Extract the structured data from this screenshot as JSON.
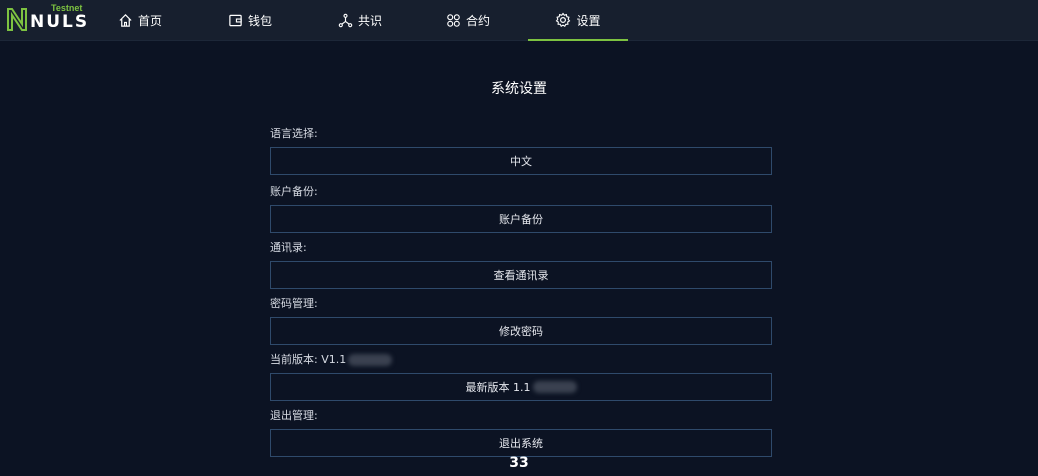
{
  "brand": {
    "name": "NULS",
    "network": "Testnet",
    "accent": "#7dc241"
  },
  "nav": {
    "items": [
      {
        "label": "首页",
        "icon": "home-icon"
      },
      {
        "label": "钱包",
        "icon": "wallet-icon"
      },
      {
        "label": "共识",
        "icon": "consensus-icon"
      },
      {
        "label": "合约",
        "icon": "contract-icon"
      },
      {
        "label": "设置",
        "icon": "gear-icon",
        "active": true
      }
    ]
  },
  "page": {
    "title": "系统设置"
  },
  "settings": {
    "language": {
      "label": "语言选择:",
      "value": "中文"
    },
    "backup": {
      "label": "账户备份:",
      "value": "账户备份"
    },
    "contacts": {
      "label": "通讯录:",
      "value": "查看通讯录"
    },
    "password": {
      "label": "密码管理:",
      "value": "修改密码"
    },
    "version": {
      "label": "当前版本: V1.1",
      "value": "最新版本 1.1"
    },
    "logout": {
      "label": "退出管理:",
      "value": "退出系统"
    }
  },
  "footer": {
    "number": "33"
  }
}
